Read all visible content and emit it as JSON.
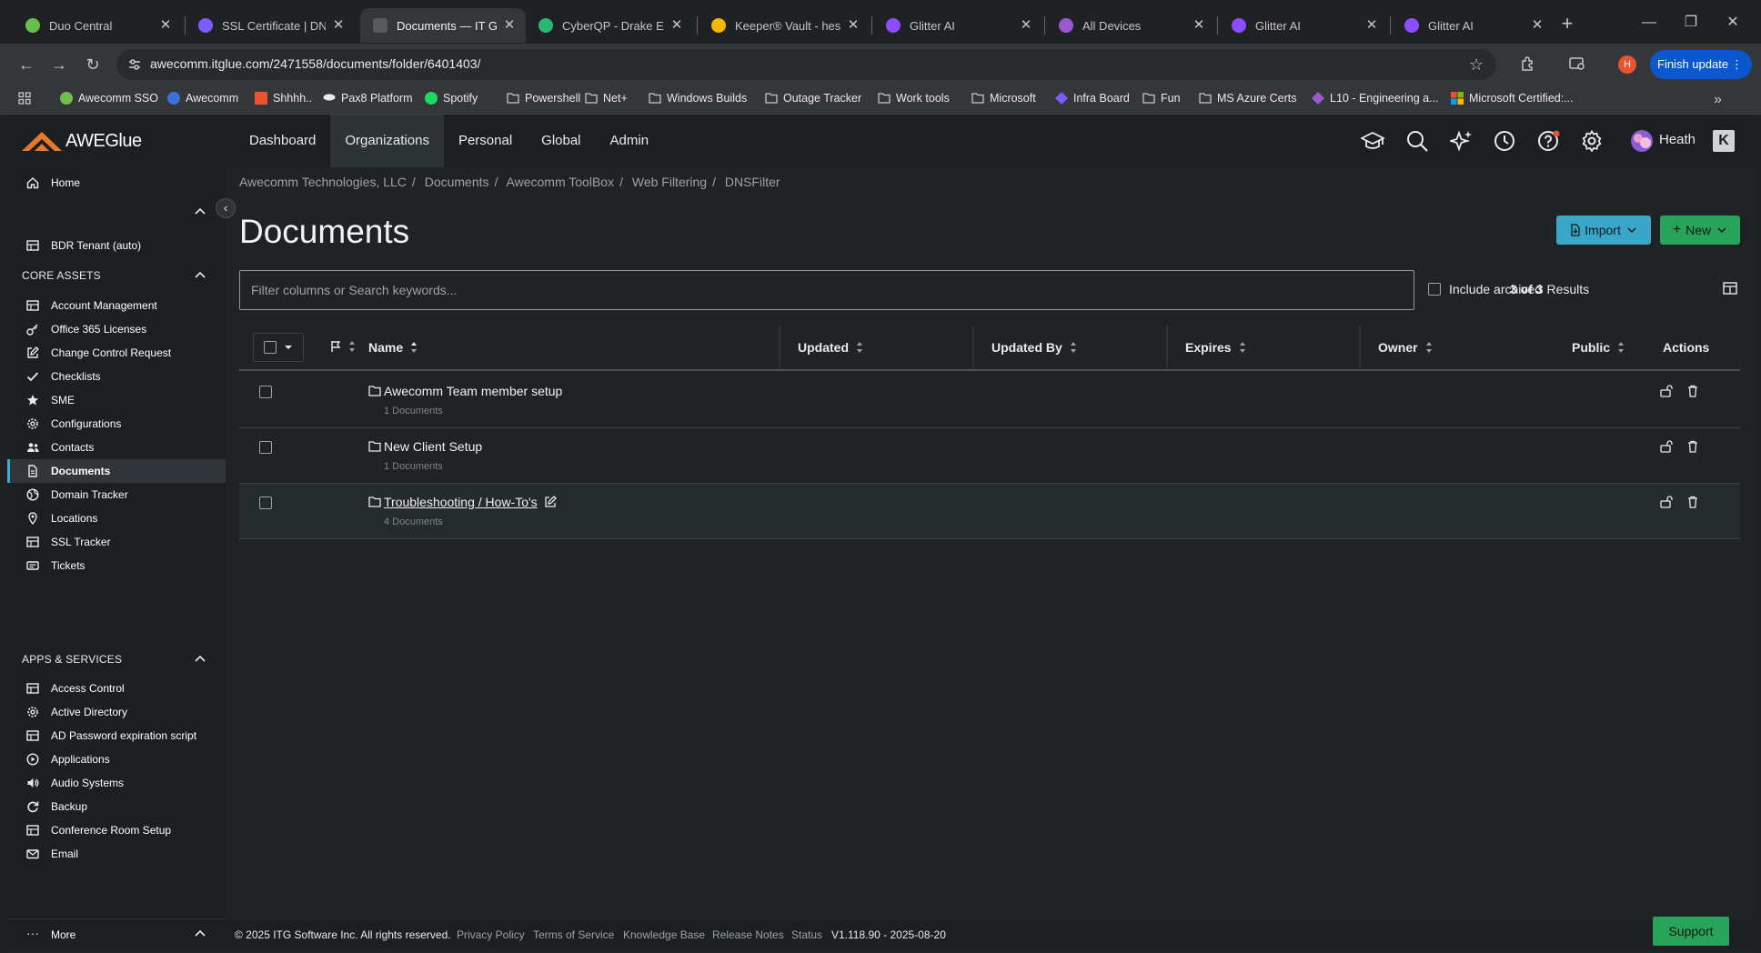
{
  "browser": {
    "tabs": [
      {
        "title": "Duo Central",
        "color": "#6dbf4b"
      },
      {
        "title": "SSL Certificate | DNSF",
        "color": "#7a5cff"
      },
      {
        "title": "Documents — IT Glue",
        "color": "#555a5e"
      },
      {
        "title": "CyberQP - Drake Ente",
        "color": "#2bb673"
      },
      {
        "title": "Keeper® Vault - hesc",
        "color": "#f5b700"
      },
      {
        "title": "Glitter AI",
        "color": "#8a4dff"
      },
      {
        "title": "All Devices",
        "color": "#9b59d0"
      },
      {
        "title": "Glitter AI",
        "color": "#8a4dff"
      },
      {
        "title": "Glitter AI",
        "color": "#8a4dff"
      }
    ],
    "url": "awecomm.itglue.com/2471558/documents/folder/6401403/",
    "profile_initial": "H",
    "finish_update": "Finish update",
    "bookmarks": [
      {
        "label": "Awecomm SSO",
        "icon": "circle-icon",
        "color": "#6dbf4b"
      },
      {
        "label": "Awecomm",
        "icon": "circle-icon",
        "color": "#3b6fd9"
      },
      {
        "label": "Shhhh..",
        "icon": "square-icon",
        "color": "#e8552e"
      },
      {
        "label": "Pax8 Platform",
        "icon": "cloud-icon",
        "color": "#e8eaed"
      },
      {
        "label": "Spotify",
        "icon": "circle-icon",
        "color": "#1ed760"
      },
      {
        "label": "Powershell",
        "icon": "folder-icon",
        "color": "#c4c7c5"
      },
      {
        "label": "Net+",
        "icon": "folder-icon",
        "color": "#c4c7c5"
      },
      {
        "label": "Windows Builds",
        "icon": "folder-icon",
        "color": "#c4c7c5"
      },
      {
        "label": "Outage Tracker",
        "icon": "folder-icon",
        "color": "#c4c7c5"
      },
      {
        "label": "Work tools",
        "icon": "folder-icon",
        "color": "#c4c7c5"
      },
      {
        "label": "Microsoft",
        "icon": "folder-icon",
        "color": "#c4c7c5"
      },
      {
        "label": "Infra Board",
        "icon": "diamond-icon",
        "color": "#7a5cff"
      },
      {
        "label": "Fun",
        "icon": "folder-icon",
        "color": "#c4c7c5"
      },
      {
        "label": "MS Azure Certs",
        "icon": "folder-icon",
        "color": "#c4c7c5"
      },
      {
        "label": "L10 - Engineering a...",
        "icon": "diamond-icon",
        "color": "#9b59d0"
      },
      {
        "label": "Microsoft Certified:...",
        "icon": "ms-grid-icon",
        "color": "#f25022"
      }
    ]
  },
  "app": {
    "logo_text": "AWEGlue",
    "nav": [
      "Dashboard",
      "Organizations",
      "Personal",
      "Global",
      "Admin"
    ],
    "active_nav": "Organizations",
    "user": "Heath",
    "user_badge": "K"
  },
  "sidebar": {
    "home": "Home",
    "pinned": "BDR Tenant (auto)",
    "core_assets_header": "CORE ASSETS",
    "core_assets": [
      {
        "label": "Account Management",
        "icon": "table-icon"
      },
      {
        "label": "Office 365 Licenses",
        "icon": "key-icon"
      },
      {
        "label": "Change Control Request",
        "icon": "edit-icon"
      },
      {
        "label": "Checklists",
        "icon": "check-icon"
      },
      {
        "label": "SME",
        "icon": "star-icon"
      },
      {
        "label": "Configurations",
        "icon": "gear-icon"
      },
      {
        "label": "Contacts",
        "icon": "people-icon"
      },
      {
        "label": "Documents",
        "icon": "document-icon"
      },
      {
        "label": "Domain Tracker",
        "icon": "globe-icon"
      },
      {
        "label": "Locations",
        "icon": "pin-icon"
      },
      {
        "label": "SSL Tracker",
        "icon": "table-icon"
      },
      {
        "label": "Tickets",
        "icon": "ticket-icon"
      }
    ],
    "active_item": "Documents",
    "apps_header": "APPS & SERVICES",
    "apps": [
      {
        "label": "Access Control",
        "icon": "table-icon"
      },
      {
        "label": "Active Directory",
        "icon": "gear-icon"
      },
      {
        "label": "AD Password expiration script",
        "icon": "table-icon"
      },
      {
        "label": "Applications",
        "icon": "play-icon"
      },
      {
        "label": "Audio Systems",
        "icon": "speaker-icon"
      },
      {
        "label": "Backup",
        "icon": "refresh-icon"
      },
      {
        "label": "Conference Room Setup",
        "icon": "table-icon"
      },
      {
        "label": "Email",
        "icon": "mail-icon"
      }
    ],
    "more": "More"
  },
  "main": {
    "breadcrumbs": [
      "Awecomm Technologies, LLC",
      "Documents",
      "Awecomm ToolBox",
      "Web Filtering",
      "DNSFilter"
    ],
    "title": "Documents",
    "import_label": "Import",
    "new_label": "New",
    "search_placeholder": "Filter columns or Search keywords...",
    "include_archived": "Include archived",
    "results_count": "3 of 3",
    "results_suffix": "Results",
    "columns": [
      "Name",
      "Updated",
      "Updated By",
      "Expires",
      "Owner",
      "Public",
      "Actions"
    ],
    "rows": [
      {
        "name": "Awecomm Team member setup",
        "sub": "1 Documents"
      },
      {
        "name": "New Client Setup",
        "sub": "1 Documents"
      },
      {
        "name": "Troubleshooting / How-To's",
        "sub": "4 Documents"
      }
    ]
  },
  "footer": {
    "copyright": "© 2025 ITG Software Inc. All rights reserved.",
    "links": [
      "Privacy Policy",
      "Terms of Service",
      "Knowledge Base",
      "Release Notes",
      "Status"
    ],
    "version": "V1.118.90 - 2025-08-20",
    "support": "Support"
  }
}
